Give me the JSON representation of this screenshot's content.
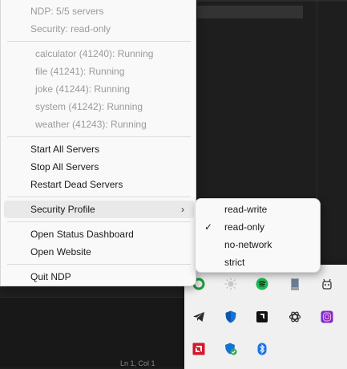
{
  "menu": {
    "status": {
      "servers": "NDP: 5/5 servers",
      "security": "Security: read-only"
    },
    "servers": [
      "calculator (41240): Running",
      "file (41241): Running",
      "joke (41244): Running",
      "system (41242): Running",
      "weather (41243): Running"
    ],
    "actions": {
      "start_all": "Start All Servers",
      "stop_all": "Stop All Servers",
      "restart_dead": "Restart Dead Servers"
    },
    "security_profile": "Security Profile",
    "links": {
      "dashboard": "Open Status Dashboard",
      "website": "Open Website"
    },
    "quit": "Quit NDP"
  },
  "submenu": {
    "items": [
      "read-write",
      "read-only",
      "no-network",
      "strict"
    ],
    "selected": "read-only",
    "check_glyph": "✓"
  },
  "tray": {
    "icons": [
      "green-app-icon",
      "sun-icon",
      "spotify-icon",
      "tablet-app-icon",
      "robot-app-icon",
      "telegram-icon",
      "defender-shield-icon",
      "amd-software-icon",
      "chatgpt-icon",
      "fingerprint-app-icon",
      "amd-icon",
      "security-shield-check-icon",
      "bluetooth-icon"
    ]
  },
  "background": {
    "status_text": "Ln 1, Col 1"
  }
}
